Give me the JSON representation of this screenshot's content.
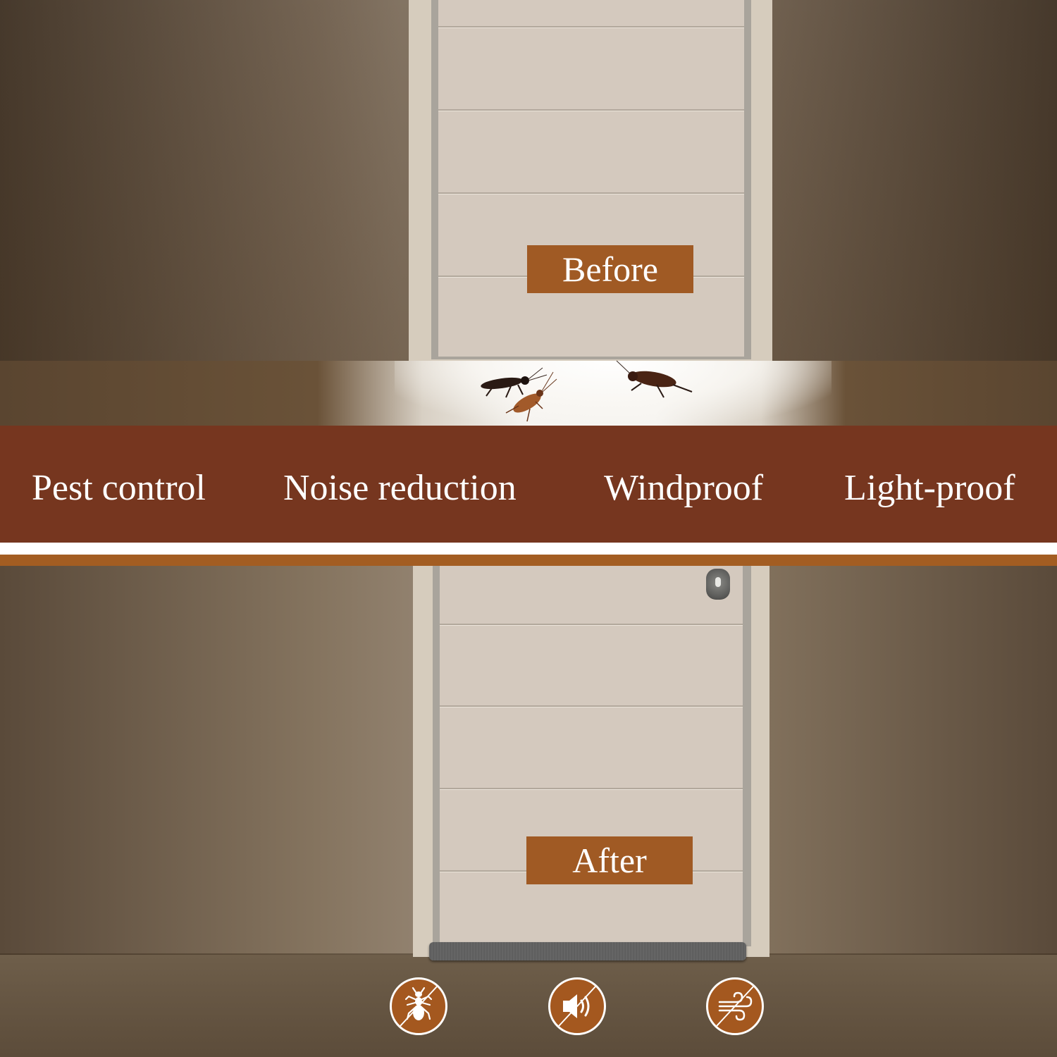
{
  "before_section": {
    "label": "Before",
    "scene": "door with gap; cockroaches entering under door",
    "pests_count": 3
  },
  "features_banner": {
    "items": [
      {
        "label": "Pest control"
      },
      {
        "label": "Noise reduction"
      },
      {
        "label": "Windproof"
      },
      {
        "label": "Light-proof"
      }
    ]
  },
  "after_section": {
    "label": "After",
    "scene": "door sealed with grey draft stopper"
  },
  "icons": [
    {
      "name": "no-pests-icon",
      "meaning": "Pest control"
    },
    {
      "name": "no-noise-icon",
      "meaning": "Noise reduction"
    },
    {
      "name": "no-wind-icon",
      "meaning": "Windproof"
    }
  ],
  "colors": {
    "banner": "#76361f",
    "badge": "#a05a24",
    "accent_stripe": "#a35d22",
    "icon_fill": "#a4581f",
    "text": "#ffffff"
  }
}
